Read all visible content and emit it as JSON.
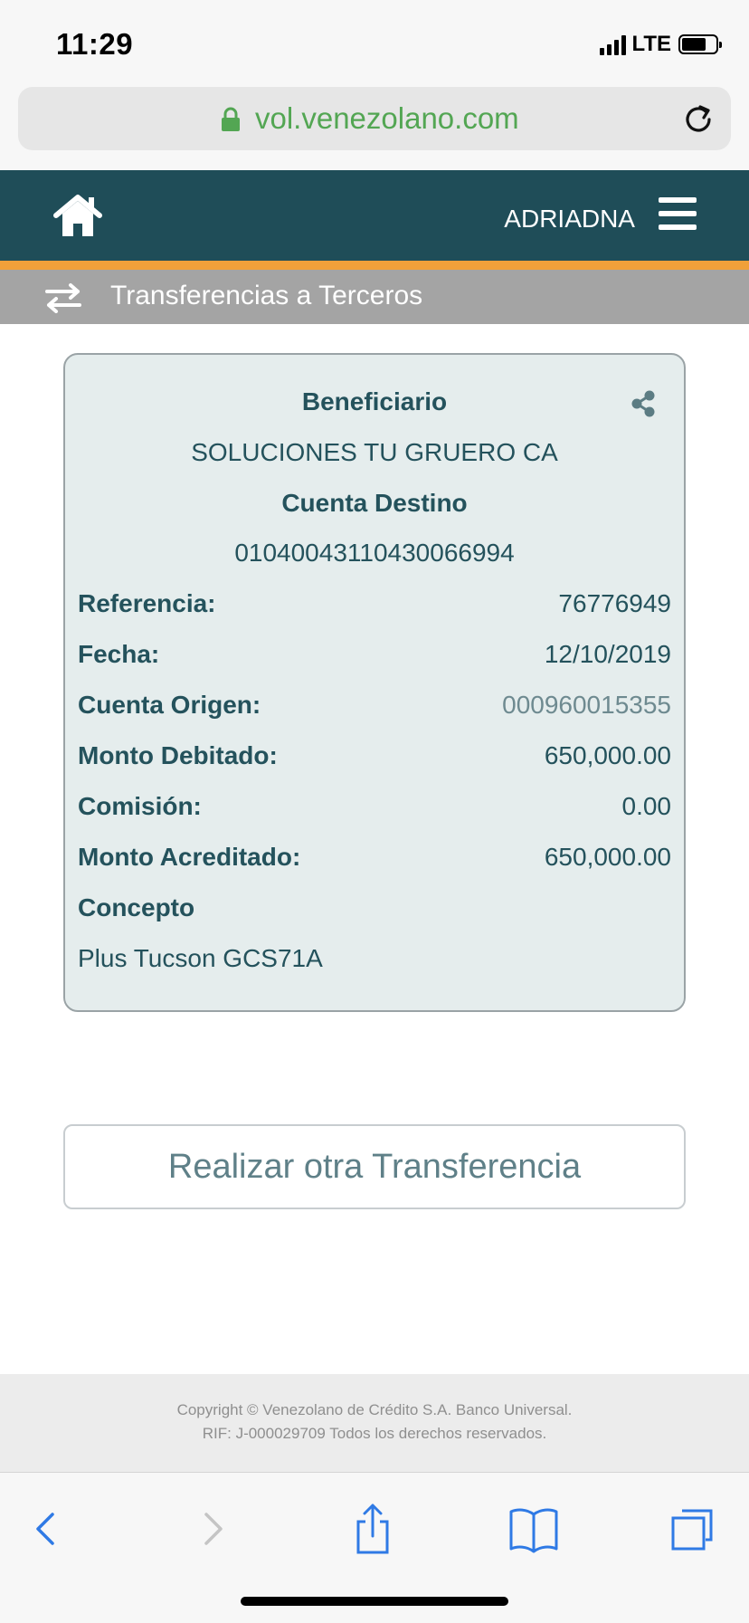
{
  "status_bar": {
    "time": "11:29",
    "network": "LTE"
  },
  "browser": {
    "url": "vol.venezolano.com"
  },
  "header": {
    "user_name": "ADRIADNA",
    "section_title": "Transferencias a Terceros"
  },
  "receipt": {
    "beneficiary_label": "Beneficiario",
    "beneficiary_value": "SOLUCIONES TU GRUERO CA",
    "dest_account_label": "Cuenta Destino",
    "dest_account_value": "01040043110430066994",
    "rows": [
      {
        "label": "Referencia:",
        "value": "76776949"
      },
      {
        "label": "Fecha:",
        "value": "12/10/2019"
      },
      {
        "label": "Cuenta Origen:",
        "value": "000960015355"
      },
      {
        "label": "Monto Debitado:",
        "value": "650,000.00"
      },
      {
        "label": "Comisión:",
        "value": "0.00"
      },
      {
        "label": "Monto Acreditado:",
        "value": "650,000.00"
      }
    ],
    "concept_label": "Concepto",
    "concept_value": "Plus Tucson GCS71A"
  },
  "action_button": "Realizar otra Transferencia",
  "footer": {
    "line1": "Copyright © Venezolano de Crédito S.A. Banco Universal.",
    "line2": "RIF: J-000029709 Todos los derechos reservados."
  },
  "colors": {
    "header_bg": "#1f4d58",
    "accent_orange": "#f0a03a",
    "card_bg": "#e5eded",
    "text_teal": "#24525c",
    "url_green": "#53a653",
    "ios_blue": "#2f7ae5"
  },
  "icons": [
    "lock-icon",
    "reload-icon",
    "home-icon",
    "menu-icon",
    "transfer-icon",
    "share-icon",
    "back-icon",
    "forward-icon",
    "share-sheet-icon",
    "bookmarks-icon",
    "tabs-icon"
  ]
}
